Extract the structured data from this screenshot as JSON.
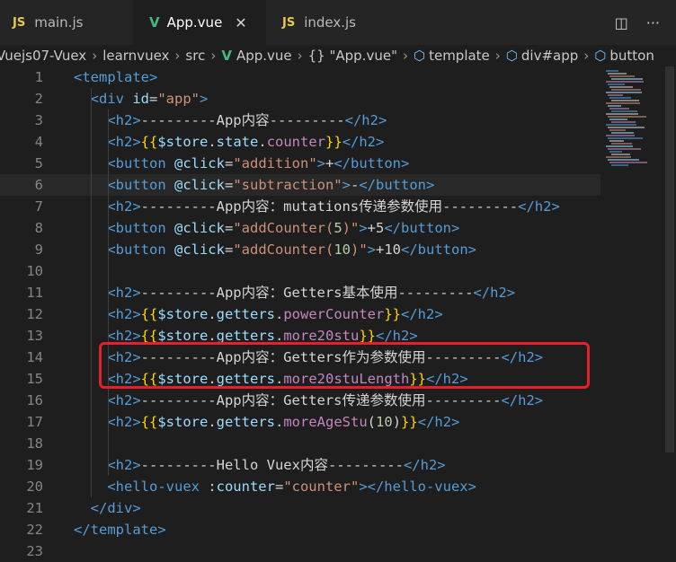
{
  "tabs": [
    {
      "icon": "JS",
      "label": "main.js",
      "active": false
    },
    {
      "icon": "V",
      "label": "App.vue",
      "active": true,
      "close": "✕"
    },
    {
      "icon": "JS",
      "label": "index.js",
      "active": false
    }
  ],
  "actions": {
    "split": "◫",
    "more": "···"
  },
  "breadcrumb": {
    "root": "Vuejs07-Vuex",
    "folder": "learnvuex",
    "src": "src",
    "file": "App.vue",
    "object": "{} \"App.vue\"",
    "template": "template",
    "div": "div#app",
    "button": "button"
  },
  "code_lines": [
    {
      "n": "1",
      "parts": [
        [
          "tag",
          "<template>"
        ]
      ]
    },
    {
      "n": "2",
      "parts": [
        [
          "tag",
          "  <div "
        ],
        [
          "attr",
          "id"
        ],
        [
          "text",
          "="
        ],
        [
          "str",
          "\"app\""
        ],
        [
          "tag",
          ">"
        ]
      ]
    },
    {
      "n": "3",
      "parts": [
        [
          "tag",
          "    <h2>"
        ],
        [
          "text",
          "---------App内容---------"
        ],
        [
          "tag",
          "</h2>"
        ]
      ]
    },
    {
      "n": "4",
      "parts": [
        [
          "tag",
          "    <h2>"
        ],
        [
          "brace",
          "{{"
        ],
        [
          "var",
          "$store"
        ],
        [
          "text",
          "."
        ],
        [
          "var",
          "state"
        ],
        [
          "text",
          "."
        ],
        [
          "prop",
          "counter"
        ],
        [
          "brace",
          "}}"
        ],
        [
          "tag",
          "</h2>"
        ]
      ]
    },
    {
      "n": "5",
      "parts": [
        [
          "tag",
          "    <button "
        ],
        [
          "attr",
          "@click"
        ],
        [
          "text",
          "="
        ],
        [
          "str",
          "\"addition\""
        ],
        [
          "tag",
          ">"
        ],
        [
          "text",
          "+"
        ],
        [
          "tag",
          "</button>"
        ]
      ]
    },
    {
      "n": "6",
      "parts": [
        [
          "tag",
          "    <button "
        ],
        [
          "attr",
          "@click"
        ],
        [
          "text",
          "="
        ],
        [
          "str",
          "\"subtraction\""
        ],
        [
          "tag",
          ">"
        ],
        [
          "text",
          "-"
        ],
        [
          "tag",
          "</button>"
        ]
      ],
      "current": true
    },
    {
      "n": "7",
      "parts": [
        [
          "tag",
          "    <h2>"
        ],
        [
          "text",
          "---------App内容：mutations传递参数使用---------"
        ],
        [
          "tag",
          "</h2>"
        ]
      ]
    },
    {
      "n": "8",
      "parts": [
        [
          "tag",
          "    <button "
        ],
        [
          "attr",
          "@click"
        ],
        [
          "text",
          "="
        ],
        [
          "str",
          "\"addCounter("
        ],
        [
          "num",
          "5"
        ],
        [
          "str",
          ")\""
        ],
        [
          "tag",
          ">"
        ],
        [
          "text",
          "+5"
        ],
        [
          "tag",
          "</button>"
        ]
      ]
    },
    {
      "n": "9",
      "parts": [
        [
          "tag",
          "    <button "
        ],
        [
          "attr",
          "@click"
        ],
        [
          "text",
          "="
        ],
        [
          "str",
          "\"addCounter("
        ],
        [
          "num",
          "10"
        ],
        [
          "str",
          ")\""
        ],
        [
          "tag",
          ">"
        ],
        [
          "text",
          "+10"
        ],
        [
          "tag",
          "</button>"
        ]
      ]
    },
    {
      "n": "10",
      "parts": []
    },
    {
      "n": "11",
      "parts": [
        [
          "tag",
          "    <h2>"
        ],
        [
          "text",
          "---------App内容：Getters基本使用---------"
        ],
        [
          "tag",
          "</h2>"
        ]
      ]
    },
    {
      "n": "12",
      "parts": [
        [
          "tag",
          "    <h2>"
        ],
        [
          "brace",
          "{{"
        ],
        [
          "var",
          "$store"
        ],
        [
          "text",
          "."
        ],
        [
          "var",
          "getters"
        ],
        [
          "text",
          "."
        ],
        [
          "prop",
          "powerCounter"
        ],
        [
          "brace",
          "}}"
        ],
        [
          "tag",
          "</h2>"
        ]
      ]
    },
    {
      "n": "13",
      "parts": [
        [
          "tag",
          "    <h2>"
        ],
        [
          "brace",
          "{{"
        ],
        [
          "var",
          "$store"
        ],
        [
          "text",
          "."
        ],
        [
          "var",
          "getters"
        ],
        [
          "text",
          "."
        ],
        [
          "prop",
          "more20stu"
        ],
        [
          "brace",
          "}}"
        ],
        [
          "tag",
          "</h2>"
        ]
      ]
    },
    {
      "n": "14",
      "parts": [
        [
          "tag",
          "    <h2>"
        ],
        [
          "text",
          "---------App内容：Getters作为参数使用---------"
        ],
        [
          "tag",
          "</h2>"
        ]
      ]
    },
    {
      "n": "15",
      "parts": [
        [
          "tag",
          "    <h2>"
        ],
        [
          "brace",
          "{{"
        ],
        [
          "var",
          "$store"
        ],
        [
          "text",
          "."
        ],
        [
          "var",
          "getters"
        ],
        [
          "text",
          "."
        ],
        [
          "prop",
          "more20stuLength"
        ],
        [
          "brace",
          "}}"
        ],
        [
          "tag",
          "</h2>"
        ]
      ]
    },
    {
      "n": "16",
      "parts": [
        [
          "tag",
          "    <h2>"
        ],
        [
          "text",
          "---------App内容：Getters传递参数使用---------"
        ],
        [
          "tag",
          "</h2>"
        ]
      ]
    },
    {
      "n": "17",
      "parts": [
        [
          "tag",
          "    <h2>"
        ],
        [
          "brace",
          "{{"
        ],
        [
          "var",
          "$store"
        ],
        [
          "text",
          "."
        ],
        [
          "var",
          "getters"
        ],
        [
          "text",
          "."
        ],
        [
          "prop",
          "moreAgeStu"
        ],
        [
          "text",
          "("
        ],
        [
          "num",
          "10"
        ],
        [
          "text",
          ")"
        ],
        [
          "brace",
          "}}"
        ],
        [
          "tag",
          "</h2>"
        ]
      ]
    },
    {
      "n": "18",
      "parts": []
    },
    {
      "n": "19",
      "parts": [
        [
          "tag",
          "    <h2>"
        ],
        [
          "text",
          "---------Hello Vuex内容---------"
        ],
        [
          "tag",
          "</h2>"
        ]
      ]
    },
    {
      "n": "20",
      "parts": [
        [
          "tag",
          "    <hello-vuex "
        ],
        [
          "attr",
          ":counter"
        ],
        [
          "text",
          "="
        ],
        [
          "str",
          "\"counter\""
        ],
        [
          "tag",
          "></hello-vuex>"
        ]
      ]
    },
    {
      "n": "21",
      "parts": [
        [
          "tag",
          "  </div>"
        ]
      ]
    },
    {
      "n": "22",
      "parts": [
        [
          "tag",
          "</template>"
        ]
      ]
    },
    {
      "n": "23",
      "parts": []
    }
  ],
  "colors": {
    "tag": "#569cd6",
    "attr": "#9cdcfe",
    "string": "#ce9178",
    "brace": "#ffd700",
    "prop": "#c586c0",
    "number": "#b5cea8",
    "highlight": "#e3202b"
  }
}
